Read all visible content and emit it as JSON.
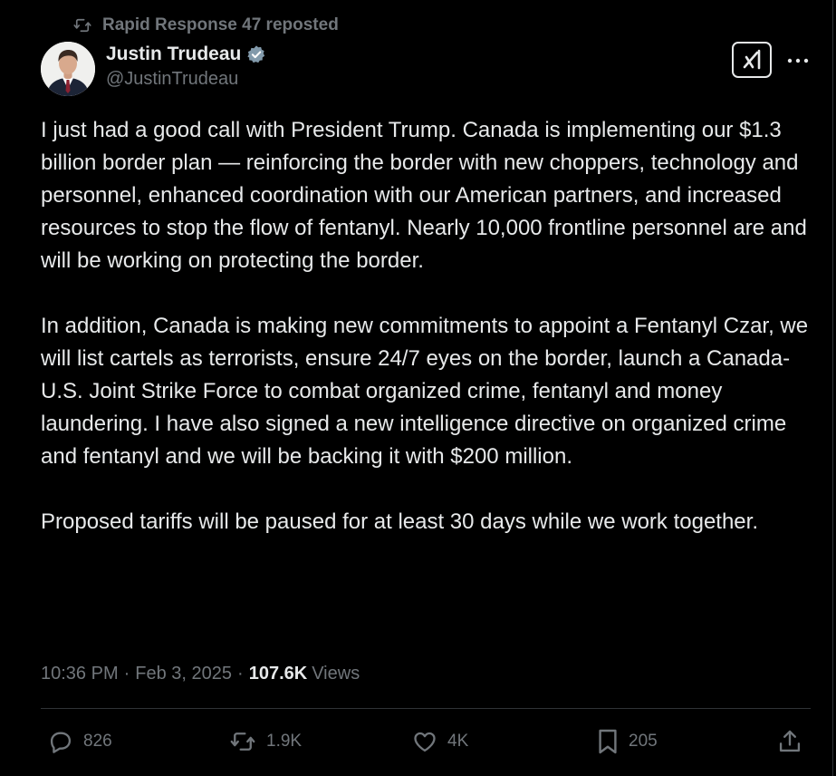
{
  "repost": {
    "text": "Rapid Response 47 reposted",
    "icon": "repost-icon"
  },
  "author": {
    "display_name": "Justin Trudeau",
    "handle": "@JustinTrudeau",
    "verified": true,
    "verified_color": "#829aab"
  },
  "header_actions": {
    "grok_icon": "grok-icon",
    "more_icon": "more-icon"
  },
  "tweet": {
    "paragraphs": [
      "I just had a good call with President Trump. Canada is implementing our $1.3 billion border plan — reinforcing the border with new choppers, technology and personnel, enhanced coordination with our American partners, and increased resources to stop the flow of fentanyl. Nearly 10,000 frontline personnel are and will be working on protecting the border.",
      "In addition, Canada is making new commitments to appoint a Fentanyl Czar, we will list cartels as terrorists, ensure 24/7 eyes on the border, launch a Canada- U.S. Joint Strike Force to combat organized crime, fentanyl and money laundering. I have also signed a new intelligence directive on organized crime and fentanyl and we will be backing it with $200 million.",
      "Proposed tariffs will be paused for at least 30 days while we work together."
    ]
  },
  "meta": {
    "time": "10:36 PM",
    "separator": "·",
    "date": "Feb 3, 2025",
    "views_count": "107.6K",
    "views_label": "Views"
  },
  "actions": {
    "replies": "826",
    "reposts": "1.9K",
    "likes": "4K",
    "bookmarks": "205"
  },
  "colors": {
    "background": "#000000",
    "primary_text": "#e7e9ea",
    "secondary_text": "#71767b",
    "divider": "#2f3336"
  }
}
